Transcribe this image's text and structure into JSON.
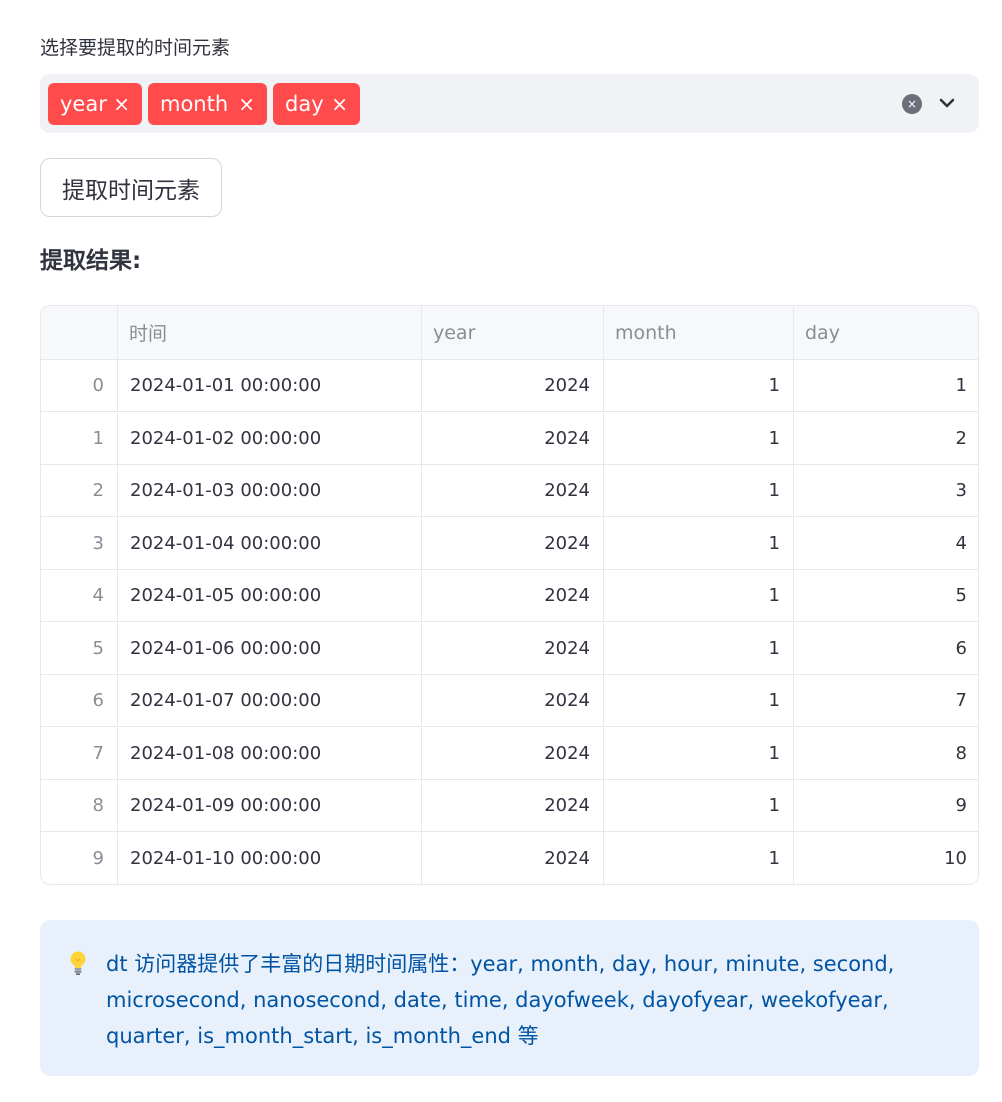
{
  "multiselect": {
    "label": "选择要提取的时间元素",
    "selected": [
      {
        "label": "year",
        "remove": "×"
      },
      {
        "label": "month",
        "remove": "×"
      },
      {
        "label": "day",
        "remove": "×"
      }
    ],
    "clear_glyph": "×",
    "accent_color": "#ff4b4b"
  },
  "button": {
    "label": "提取时间元素"
  },
  "result": {
    "heading": "提取结果:"
  },
  "table": {
    "columns": [
      "",
      "时间",
      "year",
      "month",
      "day"
    ],
    "rows": [
      {
        "index": "0",
        "time": "2024-01-01 00:00:00",
        "year": "2024",
        "month": "1",
        "day": "1"
      },
      {
        "index": "1",
        "time": "2024-01-02 00:00:00",
        "year": "2024",
        "month": "1",
        "day": "2"
      },
      {
        "index": "2",
        "time": "2024-01-03 00:00:00",
        "year": "2024",
        "month": "1",
        "day": "3"
      },
      {
        "index": "3",
        "time": "2024-01-04 00:00:00",
        "year": "2024",
        "month": "1",
        "day": "4"
      },
      {
        "index": "4",
        "time": "2024-01-05 00:00:00",
        "year": "2024",
        "month": "1",
        "day": "5"
      },
      {
        "index": "5",
        "time": "2024-01-06 00:00:00",
        "year": "2024",
        "month": "1",
        "day": "6"
      },
      {
        "index": "6",
        "time": "2024-01-07 00:00:00",
        "year": "2024",
        "month": "1",
        "day": "7"
      },
      {
        "index": "7",
        "time": "2024-01-08 00:00:00",
        "year": "2024",
        "month": "1",
        "day": "8"
      },
      {
        "index": "8",
        "time": "2024-01-09 00:00:00",
        "year": "2024",
        "month": "1",
        "day": "9"
      },
      {
        "index": "9",
        "time": "2024-01-10 00:00:00",
        "year": "2024",
        "month": "1",
        "day": "10"
      }
    ]
  },
  "info": {
    "icon": "lightbulb-icon",
    "text": "dt 访问器提供了丰富的日期时间属性：year, month, day, hour, minute, second, microsecond, nanosecond, date, time, dayofweek, dayofyear, weekofyear, quarter, is_month_start, is_month_end 等",
    "color": "#0054a3"
  }
}
